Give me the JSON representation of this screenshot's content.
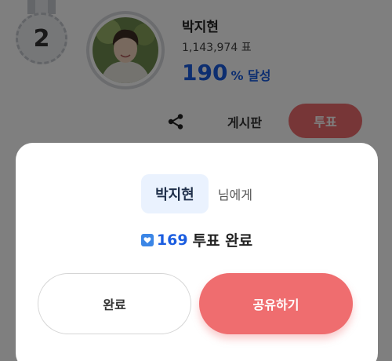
{
  "ranking_card": {
    "rank": "2",
    "artist_name": "박지현",
    "vote_count": "1,143,974 표",
    "achievement_value": "190",
    "achievement_suffix": "% 달성",
    "actions": {
      "share_icon": "share-icon",
      "board_label": "게시판",
      "vote_label": "투표"
    }
  },
  "modal": {
    "recipient_name": "박지현",
    "recipient_suffix": "님에게",
    "votes_icon": "heart-icon",
    "votes_count": "169",
    "votes_label": "투표 완료",
    "done_label": "완료",
    "share_label": "공유하기"
  },
  "colors": {
    "accent_blue": "#1b5de0",
    "accent_pink": "#ef6d6f",
    "chip_bg": "#eaf2fe",
    "overlay": "rgba(0,0,0,0.5)"
  }
}
